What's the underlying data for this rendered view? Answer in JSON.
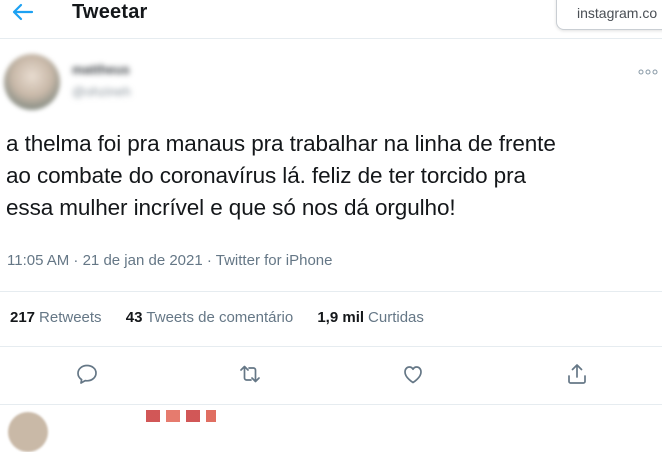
{
  "header": {
    "back_icon": "arrow-left-icon",
    "title": "Tweetar"
  },
  "watermark": {
    "text": "instagram.co"
  },
  "tweet": {
    "author_name": "mattheus",
    "author_handle": "@ohzineh",
    "lines": [
      "a thelma foi pra manaus pra trabalhar na linha de frente",
      "ao combate do coronavírus lá. feliz de ter torcido pra",
      "essa mulher incrível e que só nos dá orgulho!"
    ],
    "timestamp": "11:05 AM · 21 de jan de 2021 · ",
    "source": "Twitter for iPhone"
  },
  "stats": {
    "retweets_count": "217",
    "retweets_label": "Retweets",
    "quotes_count": "43",
    "quotes_label": "Tweets de comentário",
    "likes_count": "1,9 mil",
    "likes_label": "Curtidas"
  },
  "actions": [
    "reply-icon",
    "retweet-icon",
    "like-icon",
    "share-icon"
  ],
  "colors": {
    "accent": "#1da1f2",
    "text": "#14171a",
    "secondary": "#657786",
    "divider": "#e6ecf0"
  }
}
